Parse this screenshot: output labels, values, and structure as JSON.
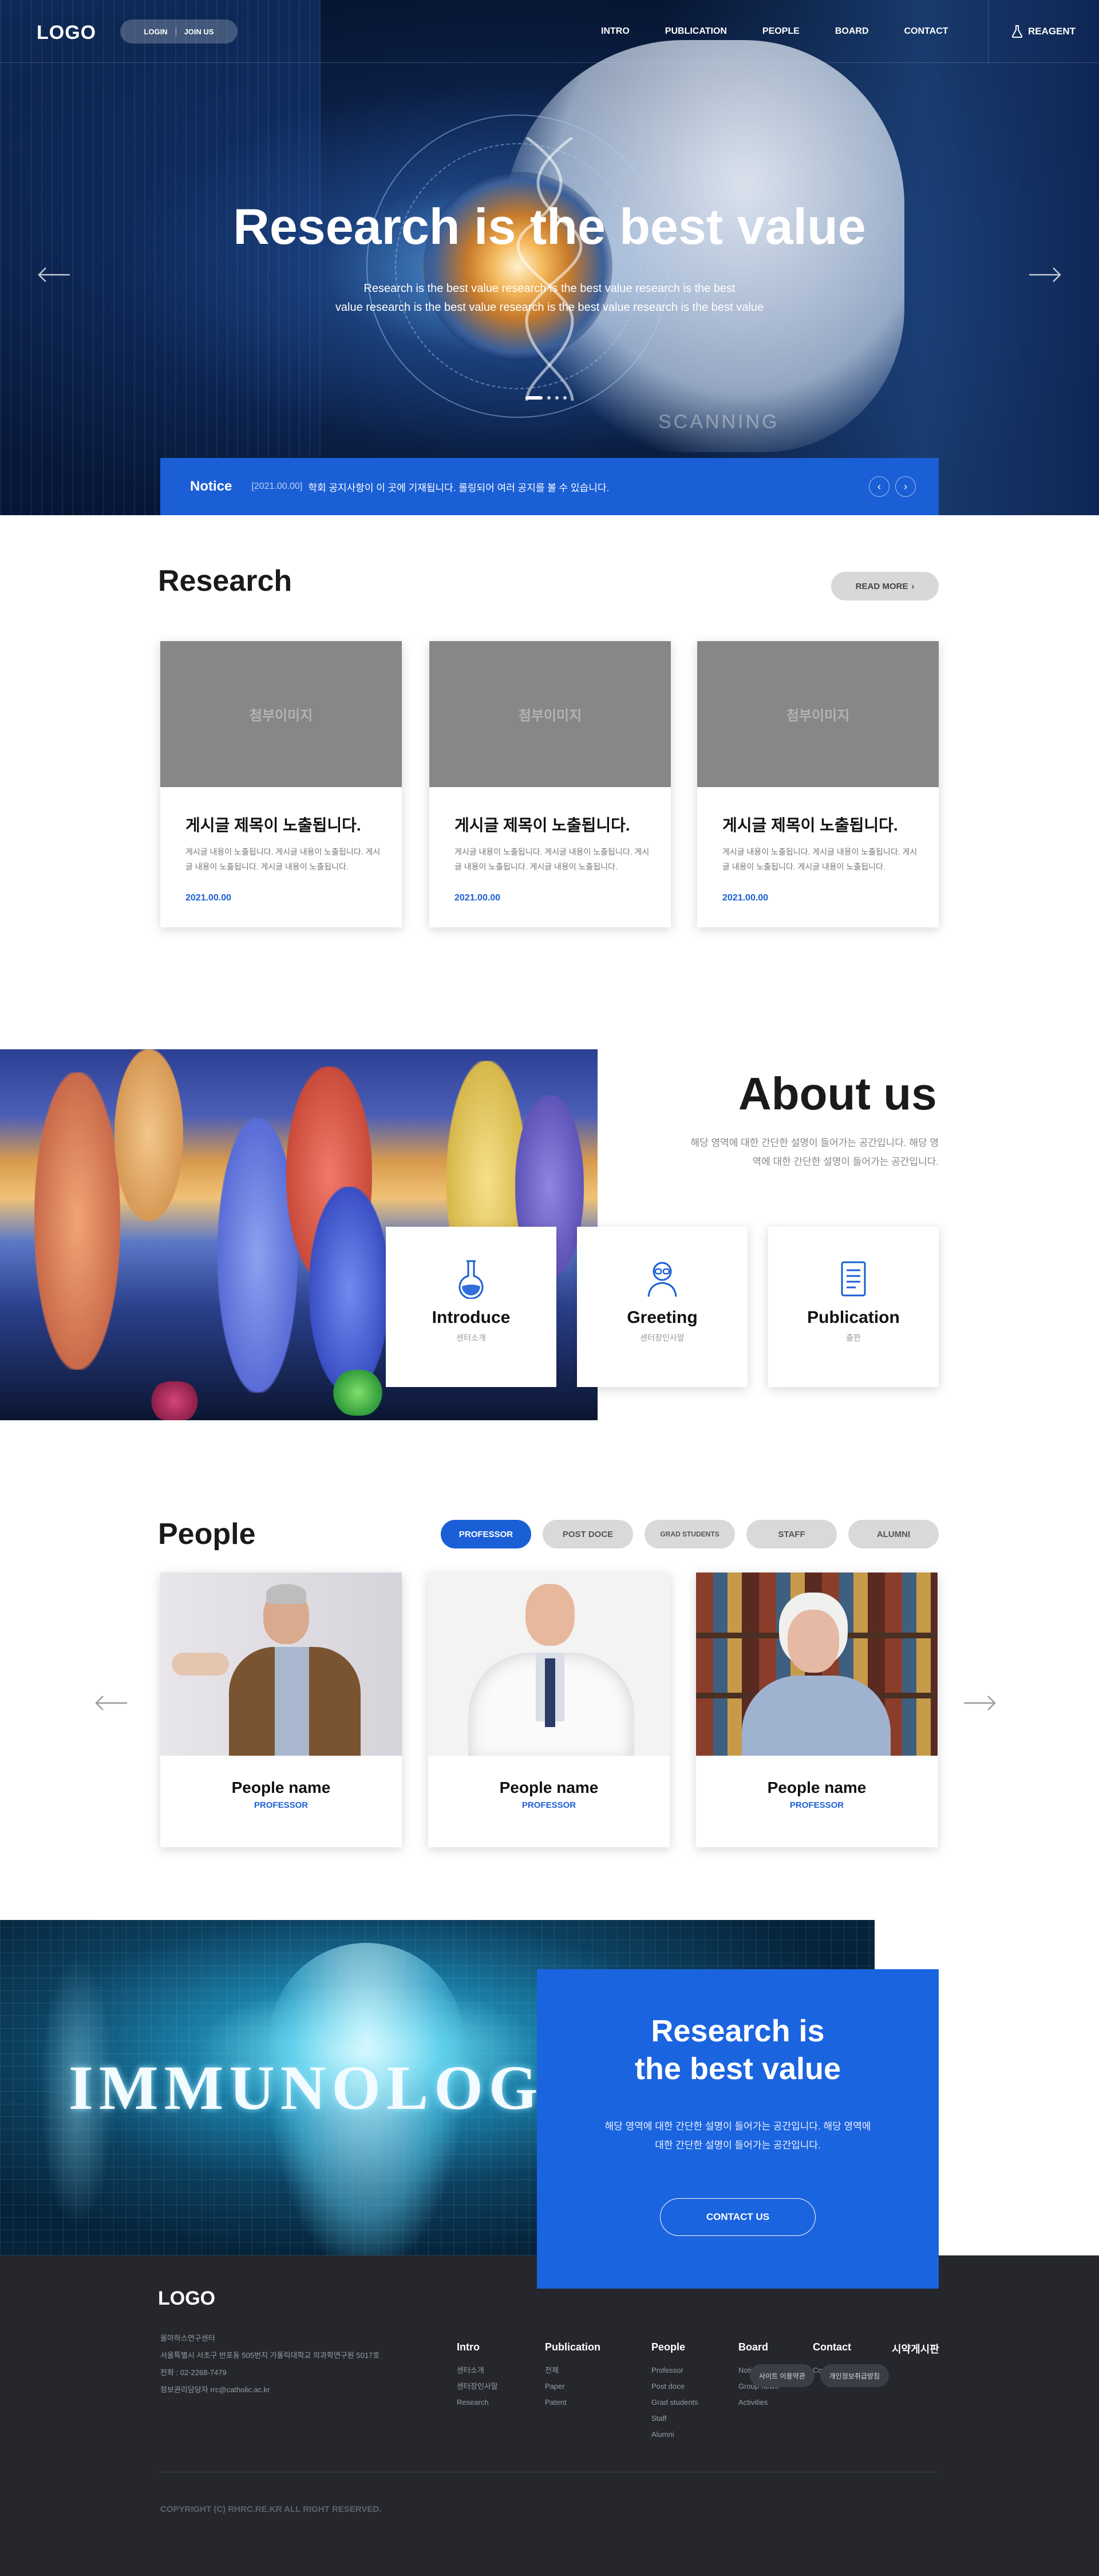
{
  "header": {
    "logo": "LOGO",
    "login": "LOGIN",
    "join": "JOIN US",
    "nav": [
      "INTRO",
      "PUBLICATION",
      "PEOPLE",
      "BOARD",
      "CONTACT"
    ],
    "reagent": "REAGENT"
  },
  "hero": {
    "title": "Research is the best value",
    "sub_line1": "Research is the best value research is the best value research is the best",
    "sub_line2": "value research is the best value research is the best value research is the best value",
    "image_text": "SCANNING",
    "slide_count": 4,
    "active_slide": 1
  },
  "notice": {
    "label": "Notice",
    "date": "[2021.00.00]",
    "text": "학회 공지사항이 이 곳에 기재됩니다. 롤링되어 여러 공지를 볼 수 있습니다."
  },
  "research": {
    "title": "Research",
    "read_more": "READ MORE",
    "cards": [
      {
        "thumb": "첨부이미지",
        "title": "게시글 제목이 노출됩니다.",
        "desc": "게시글 내용이 노출됩니다. 게시글 내용이 노출됩니다. 게시글 내용이 노출됩니다. 게시글 내용이 노출됩니다.",
        "date": "2021.00.00"
      },
      {
        "thumb": "첨부이미지",
        "title": "게시글 제목이 노출됩니다.",
        "desc": "게시글 내용이 노출됩니다. 게시글 내용이 노출됩니다. 게시글 내용이 노출됩니다. 게시글 내용이 노출됩니다.",
        "date": "2021.00.00"
      },
      {
        "thumb": "첨부이미지",
        "title": "게시글 제목이 노출됩니다.",
        "desc": "게시글 내용이 노출됩니다. 게시글 내용이 노출됩니다. 게시글 내용이 노출됩니다. 게시글 내용이 노출됩니다.",
        "date": "2021.00.00"
      }
    ]
  },
  "about": {
    "title": "About us",
    "desc": "해당 영역에 대한 간단한 설명이 들어가는 공간입니다. 해당 영역에 대한 간단한 설명이 들어가는 공간입니다.",
    "cards": [
      {
        "icon": "flask-icon",
        "title": "Introduce",
        "sub": "센터소개"
      },
      {
        "icon": "greeting-person-icon",
        "title": "Greeting",
        "sub": "센터장인사말"
      },
      {
        "icon": "book-icon",
        "title": "Publication",
        "sub": "출판"
      }
    ]
  },
  "people": {
    "title": "People",
    "tabs": [
      "PROFESSOR",
      "POST DOCE",
      "GRAD STUDENTS",
      "STAFF",
      "ALUMNI"
    ],
    "active_tab": "PROFESSOR",
    "cards": [
      {
        "name": "People name",
        "role": "PROFESSOR"
      },
      {
        "name": "People name",
        "role": "PROFESSOR"
      },
      {
        "name": "People name",
        "role": "PROFESSOR"
      }
    ]
  },
  "cta": {
    "image_text": "IMMUNOLOGY",
    "title_line1": "Research is",
    "title_line2": "the best value",
    "desc_line1": "해당 영역에 대한 간단한 설명이 들어가는 공간입니다. 해당 영역에",
    "desc_line2": "대한 간단한 설명이 들어가는 공간입니다.",
    "button": "CONTACT US"
  },
  "footer": {
    "logo": "LOGO",
    "info": [
      "울마하스연구센터",
      "서울특별시 서초구 반포동 505번지 가톨릭대학교 의과학연구원 5017호",
      "전화 : 02-2268-7479",
      "정보관리담당자 rrc@catholic.ac.kr"
    ],
    "columns": [
      {
        "title": "Intro",
        "items": [
          "센터소개",
          "센터장인사말",
          "Research"
        ]
      },
      {
        "title": "Publication",
        "items": [
          "전체",
          "Paper",
          "Patent"
        ]
      },
      {
        "title": "People",
        "items": [
          "Professor",
          "Post doce",
          "Grad students",
          "Staff",
          "Alumni"
        ]
      },
      {
        "title": "Board",
        "items": [
          "Notice",
          "Group news",
          "Activities"
        ]
      },
      {
        "title": "Contact",
        "items": [
          "Contact"
        ]
      },
      {
        "title": "시약게시판",
        "items": []
      }
    ],
    "site_links": [
      "사이트 이용약관",
      "개인정보취급방침"
    ],
    "copyright": "COPYRIGHT (C) RHRC.RE.KR ALL RIGHT RESERVED."
  },
  "colors": {
    "accent": "#1b5fd6",
    "footer_bg": "#25272d",
    "card_placeholder": "#878787"
  }
}
